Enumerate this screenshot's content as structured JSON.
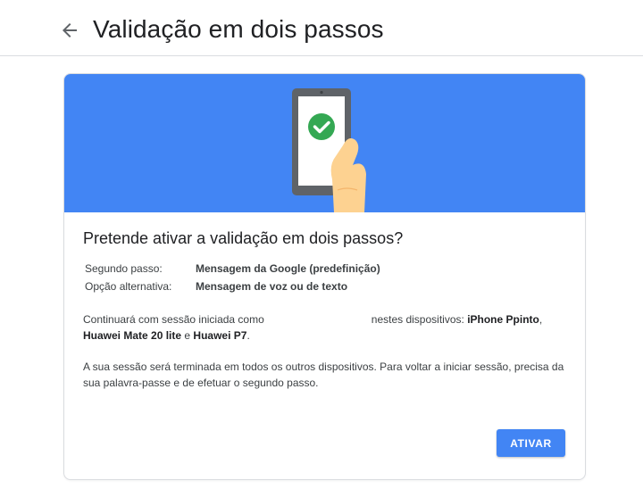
{
  "header": {
    "title": "Validação em dois passos",
    "back_icon": "arrow-back-icon"
  },
  "card": {
    "banner_illustration": "phone-check-icon",
    "question": "Pretende ativar a validação em dois passos?",
    "details": [
      {
        "label": "Segundo passo:",
        "value": "Mensagem da Google (predefinição)"
      },
      {
        "label": "Opção alternativa:",
        "value": "Mensagem de voz ou de texto"
      }
    ],
    "session_info": {
      "prefix": "Continuará com sessão iniciada como",
      "middle": "nestes dispositivos:",
      "device1": "iPhone Ppinto",
      "device2": "Huawei Mate 20 lite",
      "conj": "e",
      "device3": "Huawei P7",
      "end": "."
    },
    "signout_text": "A sua sessão será terminada em todos os outros dispositivos. Para voltar a iniciar sessão, precisa da sua palavra-passe e de efetuar o segundo passo.",
    "activate_label": "ATIVAR"
  },
  "colors": {
    "accent": "#4285f4",
    "check": "#34a853"
  }
}
